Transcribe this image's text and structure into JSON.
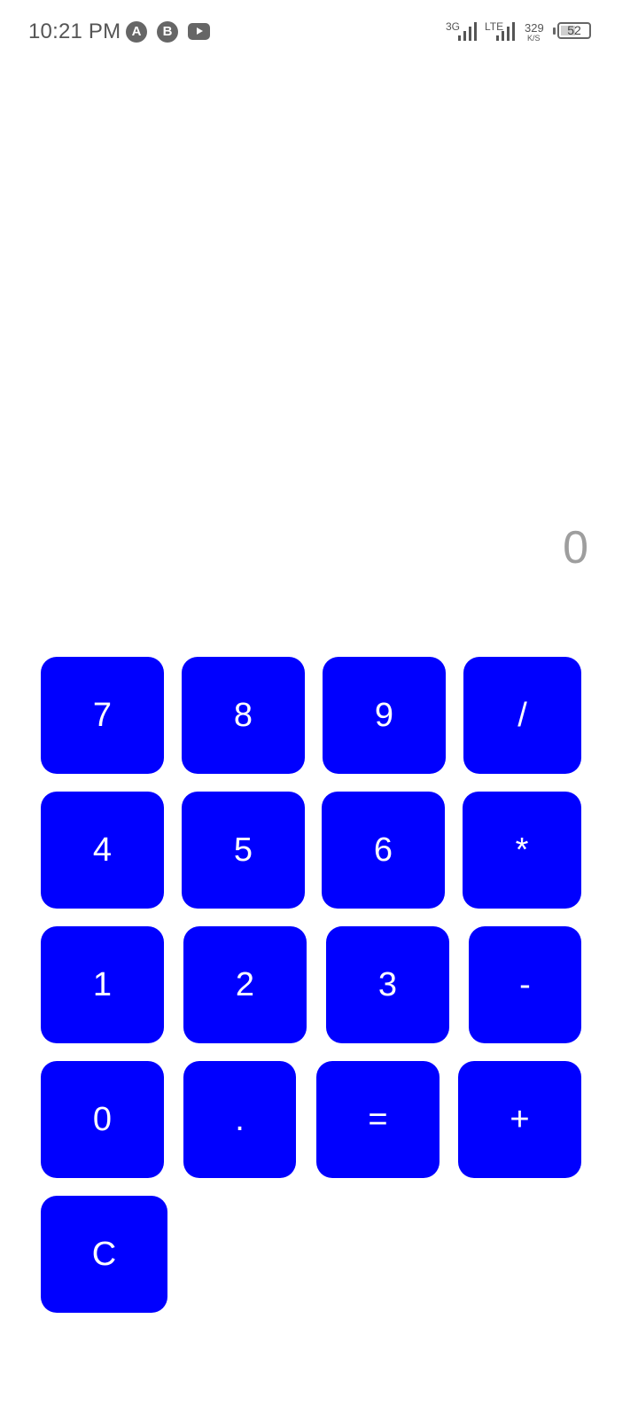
{
  "status_bar": {
    "time": "10:21 PM",
    "notification_icons": [
      "A",
      "B"
    ],
    "net1": "3G",
    "net2": "LTE",
    "speed_value": "329",
    "speed_unit": "K/S",
    "battery_level": "52"
  },
  "display": {
    "value": "0"
  },
  "keypad": {
    "k7": "7",
    "k8": "8",
    "k9": "9",
    "divide": "/",
    "k4": "4",
    "k5": "5",
    "k6": "6",
    "multiply": "*",
    "k1": "1",
    "k2": "2",
    "k3": "3",
    "minus": "-",
    "k0": "0",
    "dot": ".",
    "equals": "=",
    "plus": "+",
    "clear": "C"
  },
  "colors": {
    "key_background": "#0000ff",
    "key_text": "#ffffff",
    "display_text": "#9e9e9e"
  }
}
